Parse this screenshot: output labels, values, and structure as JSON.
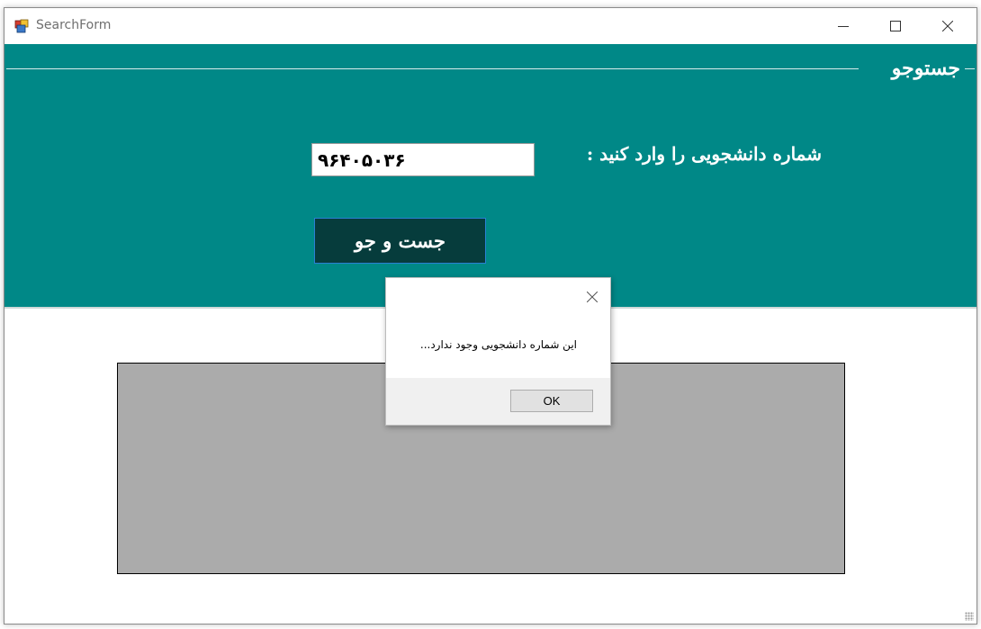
{
  "window": {
    "title": "SearchForm",
    "controls": [
      "minimize",
      "maximize",
      "close"
    ]
  },
  "search_group": {
    "title": "جستوجو",
    "student_id_label": "شماره دانشجویی را وارد کنید :",
    "student_id_value": "۹۶۴۰۵۰۳۶",
    "search_button": "جست و جو"
  },
  "message_box": {
    "text": "این شماره دانشجویی وجود ندارد...",
    "ok_label": "OK"
  },
  "colors": {
    "panel": "#008887",
    "search_button": "#063c3c",
    "grid": "#ababab"
  },
  "icons": [
    "app-icon",
    "minimize-icon",
    "maximize-icon",
    "close-icon",
    "dialog-close-icon"
  ]
}
